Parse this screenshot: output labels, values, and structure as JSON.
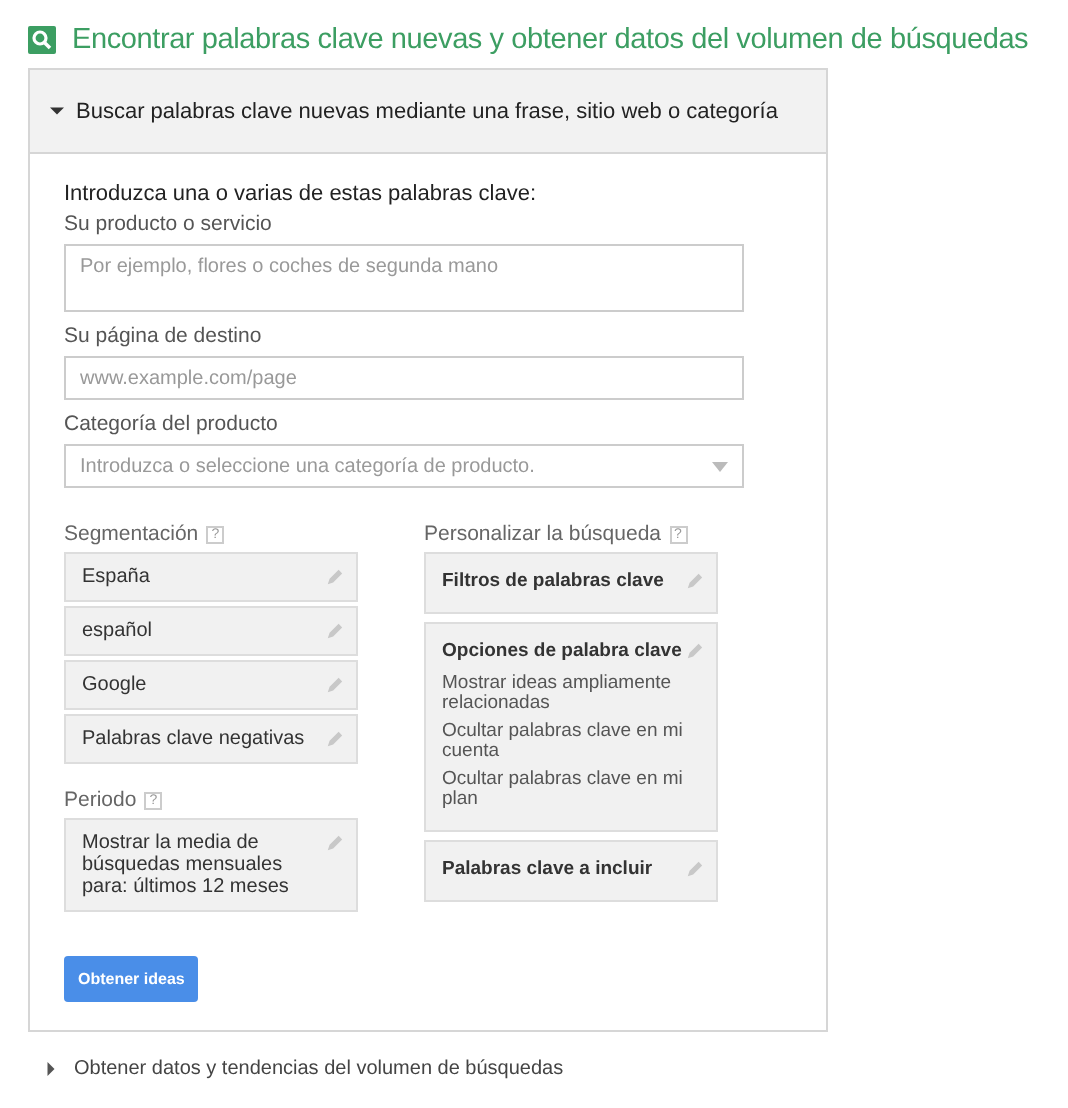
{
  "title": "Encontrar palabras clave nuevas y obtener datos del volumen de búsquedas",
  "search_section": {
    "label": "Buscar palabras clave nuevas mediante una frase, sitio web o categoría",
    "expanded": true,
    "intro": "Introduzca una o varias de estas palabras clave:",
    "fields": [
      {
        "kind": "textarea",
        "label": "Su producto o servicio",
        "placeholder": "Por ejemplo, flores o coches de segunda mano"
      },
      {
        "kind": "text",
        "label": "Su página de destino",
        "placeholder": "www.example.com/page"
      },
      {
        "kind": "select",
        "label": "Categoría del producto",
        "placeholder": "Introduzca o seleccione una categoría de producto."
      }
    ],
    "left_groups": [
      {
        "label": "Segmentación",
        "help": "?",
        "items": [
          "España",
          "español",
          "Google",
          "Palabras clave negativas"
        ]
      },
      {
        "label": "Periodo",
        "help": "?",
        "items": [
          "Mostrar la media de búsquedas mensuales para: últimos 12 meses"
        ]
      }
    ],
    "right_group": {
      "label": "Personalizar la búsqueda",
      "help": "?",
      "cards": [
        {
          "title": "Filtros de palabras clave"
        },
        {
          "title": "Opciones de palabra clave",
          "options": [
            "Mostrar ideas ampliamente relacionadas",
            "Ocultar palabras clave en mi cuenta",
            "Ocultar palabras clave en mi plan"
          ]
        },
        {
          "title": "Palabras clave a incluir"
        }
      ]
    },
    "button": "Obtener ideas"
  },
  "volume_section": {
    "label": "Obtener datos y tendencias del volumen de búsquedas",
    "expanded": false
  }
}
